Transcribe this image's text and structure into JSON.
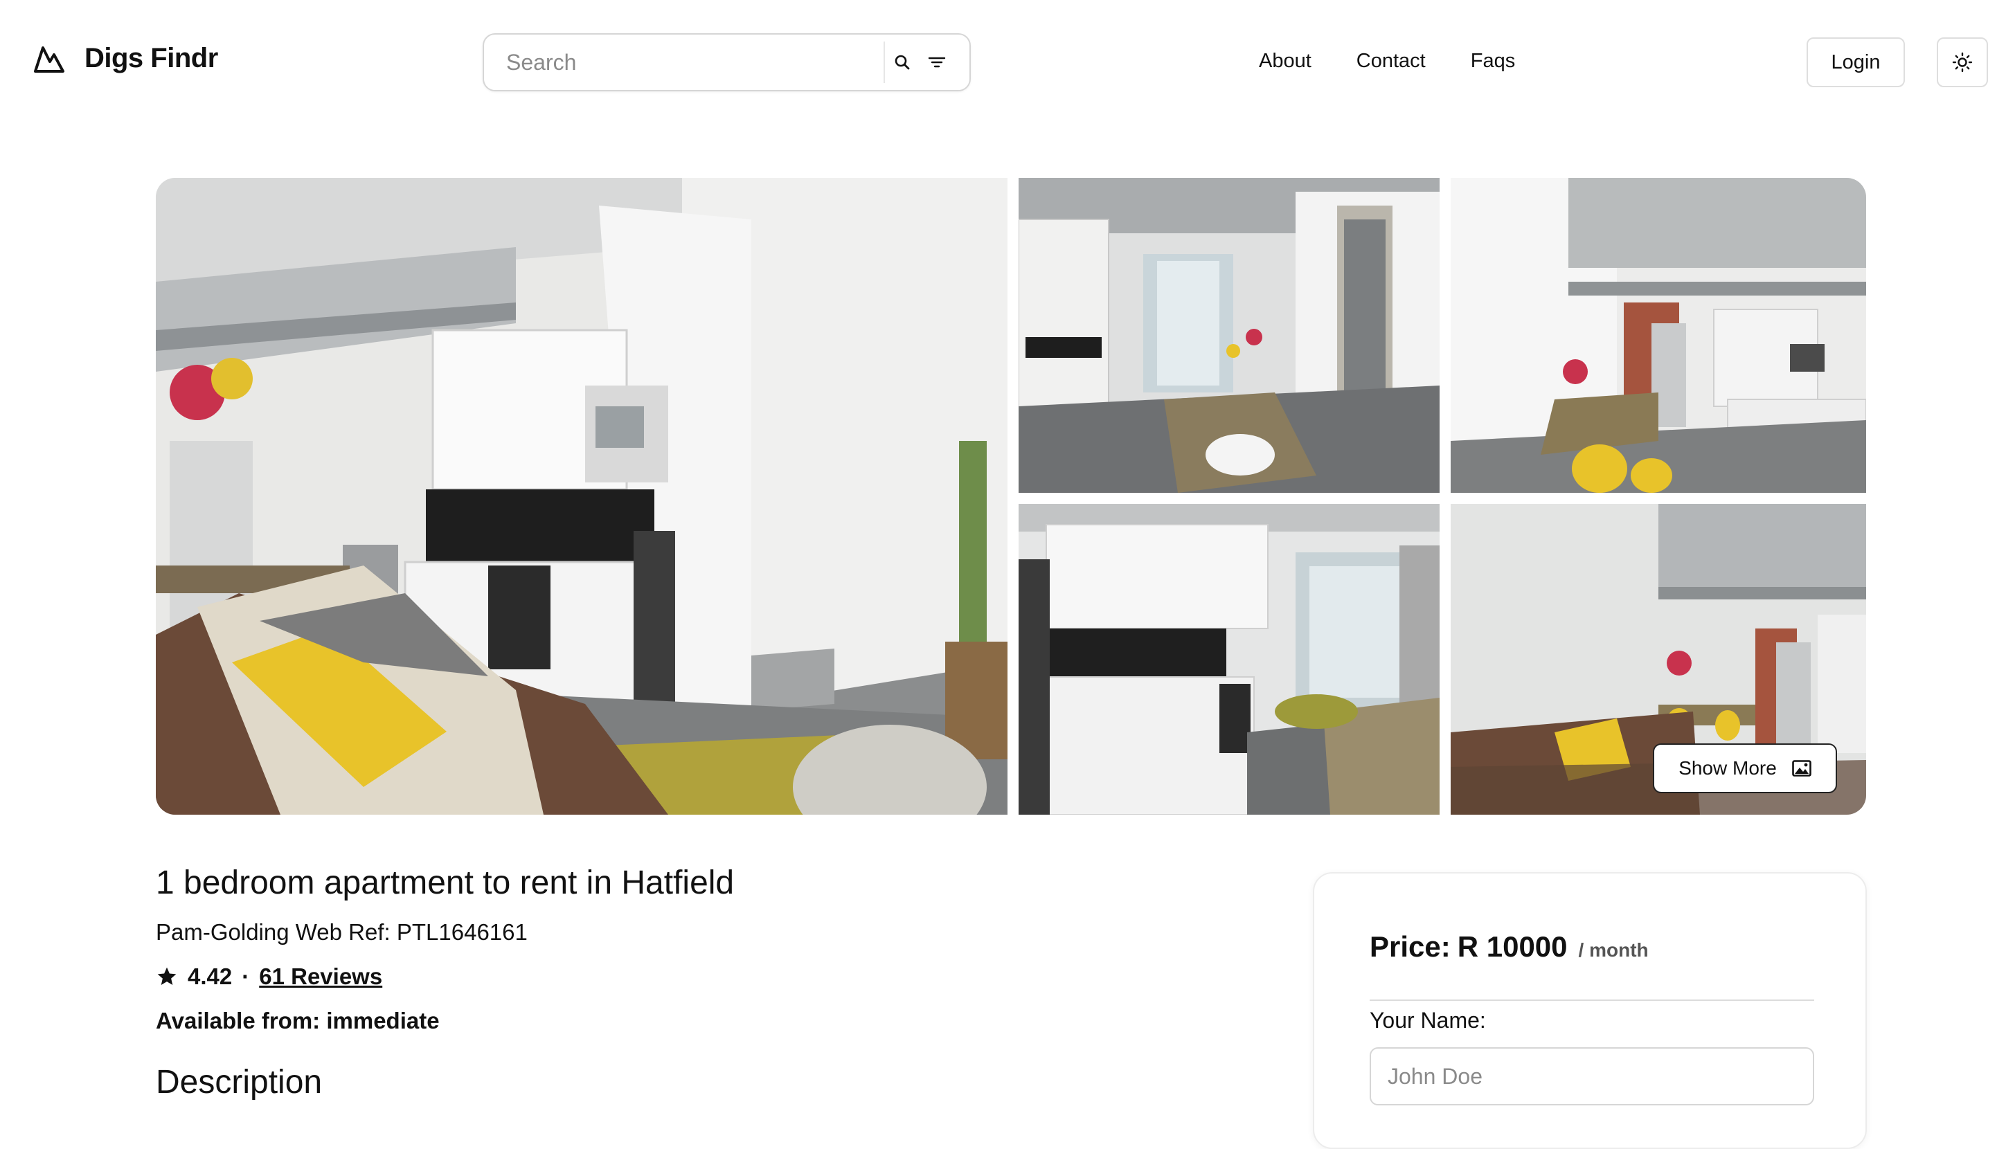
{
  "header": {
    "app_name": "Digs Findr",
    "logo_icon": "mountain-icon",
    "search": {
      "placeholder": "Search",
      "value": ""
    },
    "search_icon": "search-icon",
    "filter_icon": "filter-icon",
    "nav": [
      {
        "label": "About"
      },
      {
        "label": "Contact"
      },
      {
        "label": "Faqs"
      }
    ],
    "login_label": "Login",
    "theme_icon": "sun-icon"
  },
  "gallery": {
    "photos": [
      "kitchen-living-room",
      "dining-corridor",
      "loft-dining-view",
      "kitchen-window",
      "lounge-loft-view"
    ],
    "show_more_label": "Show More",
    "show_more_icon": "image-icon"
  },
  "listing": {
    "title": "1 bedroom apartment to rent in Hatfield",
    "web_ref": "Pam-Golding Web Ref: PTL1646161",
    "rating": "4.42",
    "separator": "·",
    "reviews_label": "61 Reviews",
    "available": "Available from: immediate",
    "description_heading": "Description"
  },
  "booking": {
    "price_label": "Price:",
    "price_value": "R 10000",
    "price_unit": "/ month",
    "name_label": "Your Name:",
    "name_placeholder": "John Doe",
    "name_value": ""
  },
  "colors": {
    "text": "#111111",
    "border": "#d6d6d6",
    "accent_yellow": "#e8c32a",
    "background": "#ffffff"
  }
}
